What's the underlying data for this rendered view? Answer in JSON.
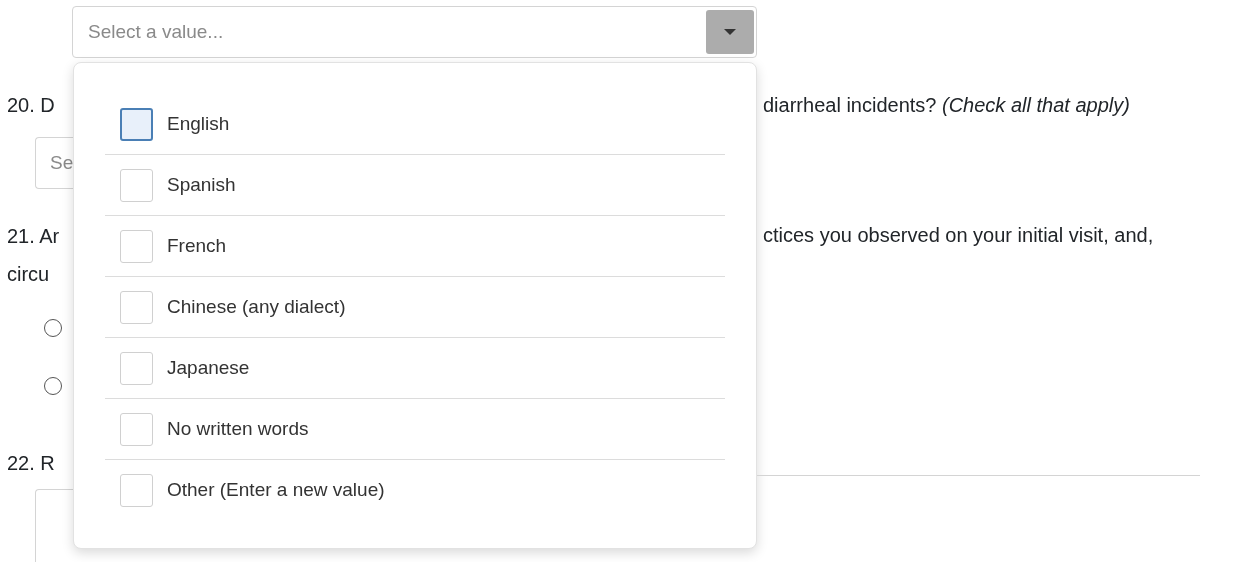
{
  "language_select": {
    "placeholder": "Select a value..."
  },
  "dropdown": {
    "options": [
      {
        "label": "English",
        "checked": false,
        "focused": true
      },
      {
        "label": "Spanish",
        "checked": false,
        "focused": false
      },
      {
        "label": "French",
        "checked": false,
        "focused": false
      },
      {
        "label": "Chinese (any dialect)",
        "checked": false,
        "focused": false
      },
      {
        "label": "Japanese",
        "checked": false,
        "focused": false
      },
      {
        "label": "No written words",
        "checked": false,
        "focused": false
      },
      {
        "label": "Other (Enter a new value)",
        "checked": false,
        "focused": false
      }
    ]
  },
  "form_left": [
    {
      "kind": "text",
      "text": "20. D"
    },
    {
      "kind": "select",
      "placeholder": "Se"
    },
    {
      "kind": "text",
      "text": "21. Ar"
    },
    {
      "kind": "text",
      "text": "circu"
    },
    {
      "kind": "radio",
      "selected": false
    },
    {
      "kind": "radio",
      "selected": false
    },
    {
      "kind": "text",
      "text": "22. R"
    },
    {
      "kind": "textarea"
    }
  ],
  "form_right": [
    {
      "kind": "text",
      "text": "diarrheal incidents? *(Check all that apply)*"
    },
    {
      "kind": "text",
      "text": "ctices you observed on your initial visit, and,"
    },
    {
      "kind": "textarea"
    }
  ]
}
